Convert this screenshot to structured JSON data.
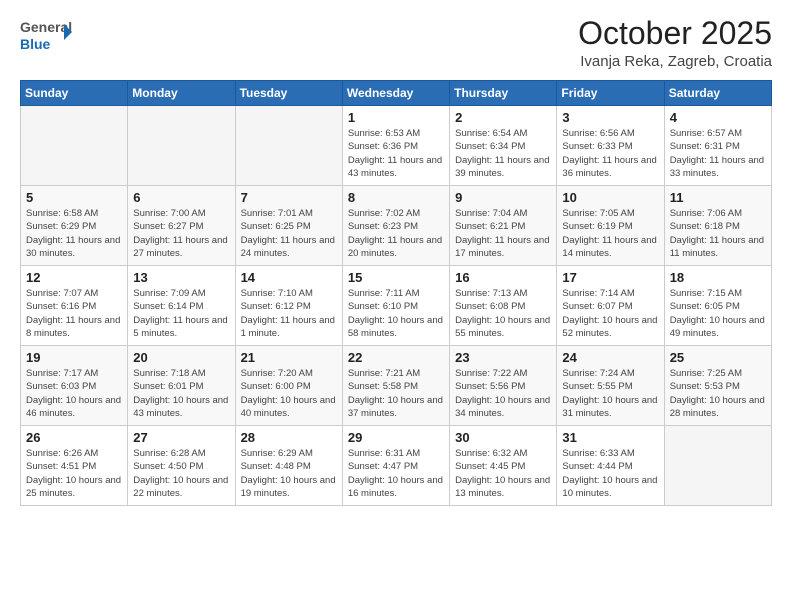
{
  "header": {
    "logo_general": "General",
    "logo_blue": "Blue",
    "month_title": "October 2025",
    "location": "Ivanja Reka, Zagreb, Croatia"
  },
  "days_of_week": [
    "Sunday",
    "Monday",
    "Tuesday",
    "Wednesday",
    "Thursday",
    "Friday",
    "Saturday"
  ],
  "weeks": [
    [
      {
        "day": "",
        "info": ""
      },
      {
        "day": "",
        "info": ""
      },
      {
        "day": "",
        "info": ""
      },
      {
        "day": "1",
        "info": "Sunrise: 6:53 AM\nSunset: 6:36 PM\nDaylight: 11 hours and 43 minutes."
      },
      {
        "day": "2",
        "info": "Sunrise: 6:54 AM\nSunset: 6:34 PM\nDaylight: 11 hours and 39 minutes."
      },
      {
        "day": "3",
        "info": "Sunrise: 6:56 AM\nSunset: 6:33 PM\nDaylight: 11 hours and 36 minutes."
      },
      {
        "day": "4",
        "info": "Sunrise: 6:57 AM\nSunset: 6:31 PM\nDaylight: 11 hours and 33 minutes."
      }
    ],
    [
      {
        "day": "5",
        "info": "Sunrise: 6:58 AM\nSunset: 6:29 PM\nDaylight: 11 hours and 30 minutes."
      },
      {
        "day": "6",
        "info": "Sunrise: 7:00 AM\nSunset: 6:27 PM\nDaylight: 11 hours and 27 minutes."
      },
      {
        "day": "7",
        "info": "Sunrise: 7:01 AM\nSunset: 6:25 PM\nDaylight: 11 hours and 24 minutes."
      },
      {
        "day": "8",
        "info": "Sunrise: 7:02 AM\nSunset: 6:23 PM\nDaylight: 11 hours and 20 minutes."
      },
      {
        "day": "9",
        "info": "Sunrise: 7:04 AM\nSunset: 6:21 PM\nDaylight: 11 hours and 17 minutes."
      },
      {
        "day": "10",
        "info": "Sunrise: 7:05 AM\nSunset: 6:19 PM\nDaylight: 11 hours and 14 minutes."
      },
      {
        "day": "11",
        "info": "Sunrise: 7:06 AM\nSunset: 6:18 PM\nDaylight: 11 hours and 11 minutes."
      }
    ],
    [
      {
        "day": "12",
        "info": "Sunrise: 7:07 AM\nSunset: 6:16 PM\nDaylight: 11 hours and 8 minutes."
      },
      {
        "day": "13",
        "info": "Sunrise: 7:09 AM\nSunset: 6:14 PM\nDaylight: 11 hours and 5 minutes."
      },
      {
        "day": "14",
        "info": "Sunrise: 7:10 AM\nSunset: 6:12 PM\nDaylight: 11 hours and 1 minute."
      },
      {
        "day": "15",
        "info": "Sunrise: 7:11 AM\nSunset: 6:10 PM\nDaylight: 10 hours and 58 minutes."
      },
      {
        "day": "16",
        "info": "Sunrise: 7:13 AM\nSunset: 6:08 PM\nDaylight: 10 hours and 55 minutes."
      },
      {
        "day": "17",
        "info": "Sunrise: 7:14 AM\nSunset: 6:07 PM\nDaylight: 10 hours and 52 minutes."
      },
      {
        "day": "18",
        "info": "Sunrise: 7:15 AM\nSunset: 6:05 PM\nDaylight: 10 hours and 49 minutes."
      }
    ],
    [
      {
        "day": "19",
        "info": "Sunrise: 7:17 AM\nSunset: 6:03 PM\nDaylight: 10 hours and 46 minutes."
      },
      {
        "day": "20",
        "info": "Sunrise: 7:18 AM\nSunset: 6:01 PM\nDaylight: 10 hours and 43 minutes."
      },
      {
        "day": "21",
        "info": "Sunrise: 7:20 AM\nSunset: 6:00 PM\nDaylight: 10 hours and 40 minutes."
      },
      {
        "day": "22",
        "info": "Sunrise: 7:21 AM\nSunset: 5:58 PM\nDaylight: 10 hours and 37 minutes."
      },
      {
        "day": "23",
        "info": "Sunrise: 7:22 AM\nSunset: 5:56 PM\nDaylight: 10 hours and 34 minutes."
      },
      {
        "day": "24",
        "info": "Sunrise: 7:24 AM\nSunset: 5:55 PM\nDaylight: 10 hours and 31 minutes."
      },
      {
        "day": "25",
        "info": "Sunrise: 7:25 AM\nSunset: 5:53 PM\nDaylight: 10 hours and 28 minutes."
      }
    ],
    [
      {
        "day": "26",
        "info": "Sunrise: 6:26 AM\nSunset: 4:51 PM\nDaylight: 10 hours and 25 minutes."
      },
      {
        "day": "27",
        "info": "Sunrise: 6:28 AM\nSunset: 4:50 PM\nDaylight: 10 hours and 22 minutes."
      },
      {
        "day": "28",
        "info": "Sunrise: 6:29 AM\nSunset: 4:48 PM\nDaylight: 10 hours and 19 minutes."
      },
      {
        "day": "29",
        "info": "Sunrise: 6:31 AM\nSunset: 4:47 PM\nDaylight: 10 hours and 16 minutes."
      },
      {
        "day": "30",
        "info": "Sunrise: 6:32 AM\nSunset: 4:45 PM\nDaylight: 10 hours and 13 minutes."
      },
      {
        "day": "31",
        "info": "Sunrise: 6:33 AM\nSunset: 4:44 PM\nDaylight: 10 hours and 10 minutes."
      },
      {
        "day": "",
        "info": ""
      }
    ]
  ]
}
